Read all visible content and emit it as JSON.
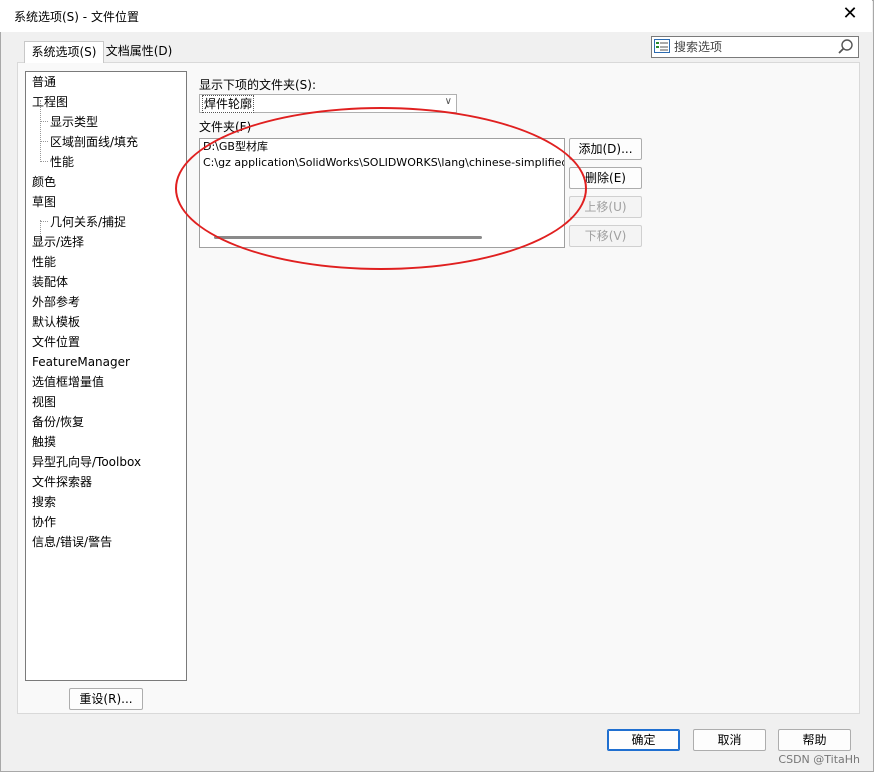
{
  "window": {
    "title": "系统选项(S) - 文件位置",
    "close_glyph": "✕"
  },
  "tabs": [
    {
      "label": "系统选项(S)"
    },
    {
      "label": "文档属性(D)"
    }
  ],
  "search": {
    "placeholder": "搜索选项",
    "icon": "search-icon"
  },
  "tree": {
    "items": [
      {
        "label": "普通"
      },
      {
        "label": "工程图"
      },
      {
        "label": "显示类型"
      },
      {
        "label": "区域剖面线/填充"
      },
      {
        "label": "性能"
      },
      {
        "label": "颜色"
      },
      {
        "label": "草图"
      },
      {
        "label": "几何关系/捕捉"
      },
      {
        "label": "显示/选择"
      },
      {
        "label": "性能"
      },
      {
        "label": "装配体"
      },
      {
        "label": "外部参考"
      },
      {
        "label": "默认模板"
      },
      {
        "label": "文件位置"
      },
      {
        "label": "FeatureManager"
      },
      {
        "label": "选值框增量值"
      },
      {
        "label": "视图"
      },
      {
        "label": "备份/恢复"
      },
      {
        "label": "触摸"
      },
      {
        "label": "异型孔向导/Toolbox"
      },
      {
        "label": "文件探索器"
      },
      {
        "label": "搜索"
      },
      {
        "label": "协作"
      },
      {
        "label": "信息/错误/警告"
      }
    ]
  },
  "reset_label": "重设(R)...",
  "show_folders": {
    "label": "显示下项的文件夹(S):",
    "selected": "焊件轮廓"
  },
  "folders": {
    "label": "文件夹(F)",
    "rows": [
      "D:\\GB型材库",
      "C:\\gz application\\SolidWorks\\SOLIDWORKS\\lang\\chinese-simplified\\w"
    ]
  },
  "side_buttons": {
    "add": "添加(D)...",
    "delete": "删除(E)",
    "up": "上移(U)",
    "down": "下移(V)"
  },
  "footer": {
    "ok": "确定",
    "cancel": "取消",
    "help": "帮助"
  },
  "watermark": "CSDN @TitaHh",
  "colors": {
    "annotation": "#e02020",
    "default_button_border": "#1f6fd0"
  }
}
